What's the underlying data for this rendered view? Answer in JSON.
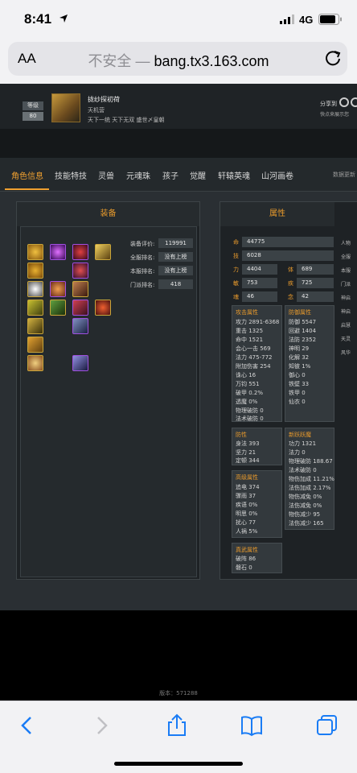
{
  "status": {
    "time": "8:41",
    "network": "4G"
  },
  "browser": {
    "aa": "AA",
    "insecure": "不安全",
    "sep": " — ",
    "domain": "bang.tx3.163.com"
  },
  "header": {
    "level_label": "等级",
    "level_value": "80",
    "name": "拢纱探初荷",
    "school": "天机营",
    "server": "天下一统 天下无双 盛世〆皇朝",
    "share_label": "分享到",
    "share_hint": "快点来展示您"
  },
  "tabs": [
    "角色信息",
    "技能特技",
    "灵兽",
    "元魂珠",
    "孩子",
    "觉醒",
    "轩辕英魂",
    "山河画卷"
  ],
  "tab_right": "数据更新",
  "equip": {
    "title": "装备",
    "rows": [
      {
        "label": "装备评价:",
        "value": "119991"
      },
      {
        "label": "全服排名:",
        "value": "没有上榜"
      },
      {
        "label": "本服排名:",
        "value": "没有上榜"
      },
      {
        "label": "门派排名:",
        "value": "418"
      }
    ]
  },
  "attr": {
    "title": "属性",
    "hp": {
      "label": "命",
      "value": "44775"
    },
    "mp": {
      "label": "技",
      "value": "6028"
    },
    "pairs": [
      {
        "l1": "力",
        "v1": "4404",
        "l2": "体",
        "v2": "689"
      },
      {
        "l1": "敏",
        "v1": "753",
        "l2": "疾",
        "v2": "725"
      },
      {
        "l1": "魂",
        "v1": "46",
        "l2": "念",
        "v2": "42"
      }
    ],
    "side_labels": [
      "人物",
      "全服",
      "本服",
      "门派",
      "神启",
      "神启",
      "启慧",
      "天灵",
      "风华"
    ],
    "attack": {
      "title": "攻击属性",
      "lines": [
        "攻力 2891-6368",
        "重击 1325",
        "命中 1521",
        "会心一击 569",
        "法力 475-772",
        "附加伤害 254",
        "诛心 16",
        "万钧 551",
        "破甲 0.2%",
        "透魔 0%",
        "物理破防 0",
        "法术破防 0"
      ]
    },
    "defense": {
      "title": "防御属性",
      "lines": [
        "防御 5547",
        "回避 1404",
        "法防 2352",
        "神明 29",
        "化解 32",
        "知彼 1%",
        "御心 0",
        "铁壁 33",
        "铁甲 0",
        "仙衣 0"
      ]
    },
    "speed": {
      "title": "防性",
      "lines": [
        "身法 393",
        "坚力 21",
        "定顿 344"
      ]
    },
    "advanced": {
      "title": "高级属性",
      "lines": [
        "追电 374",
        "骤雨 37",
        "疾语 0%",
        "明思 0%",
        "扰心 77",
        "人祸 5%"
      ]
    },
    "martial": {
      "title": "真武属性",
      "lines": [
        "破阵 86",
        "磐石 0"
      ]
    },
    "newrun": {
      "title": "新跃跃魔",
      "lines": [
        "功力 1321",
        "法力 0",
        "物理破防 188.67",
        "法术破防 0",
        "物伤加成 11.21%",
        "法伤加成 2.17%",
        "物伤减免 0%",
        "法伤减免 0%",
        "物伤减少 95",
        "法伤减少 165"
      ]
    }
  },
  "version": "版本：571288",
  "colors": {
    "accent": "#e89a2c",
    "link": "#1a7cf5",
    "panel": "#1e2225"
  }
}
